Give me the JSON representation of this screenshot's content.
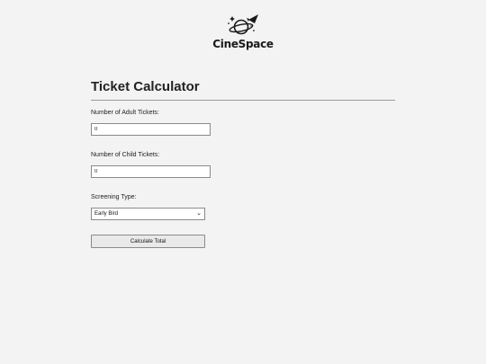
{
  "brand": {
    "logo_icon": "planet-rocket-icon",
    "name": "CineSpace"
  },
  "calculator": {
    "title": "Ticket Calculator",
    "adult": {
      "label": "Number of Adult Tickets:",
      "value": "0"
    },
    "child": {
      "label": "Number of Child Tickets:",
      "value": "0"
    },
    "screening": {
      "label": "Screening Type:",
      "selected": "Early Bird",
      "chevron_icon": "chevron-down-icon"
    },
    "button_label": "Calculate Total"
  }
}
